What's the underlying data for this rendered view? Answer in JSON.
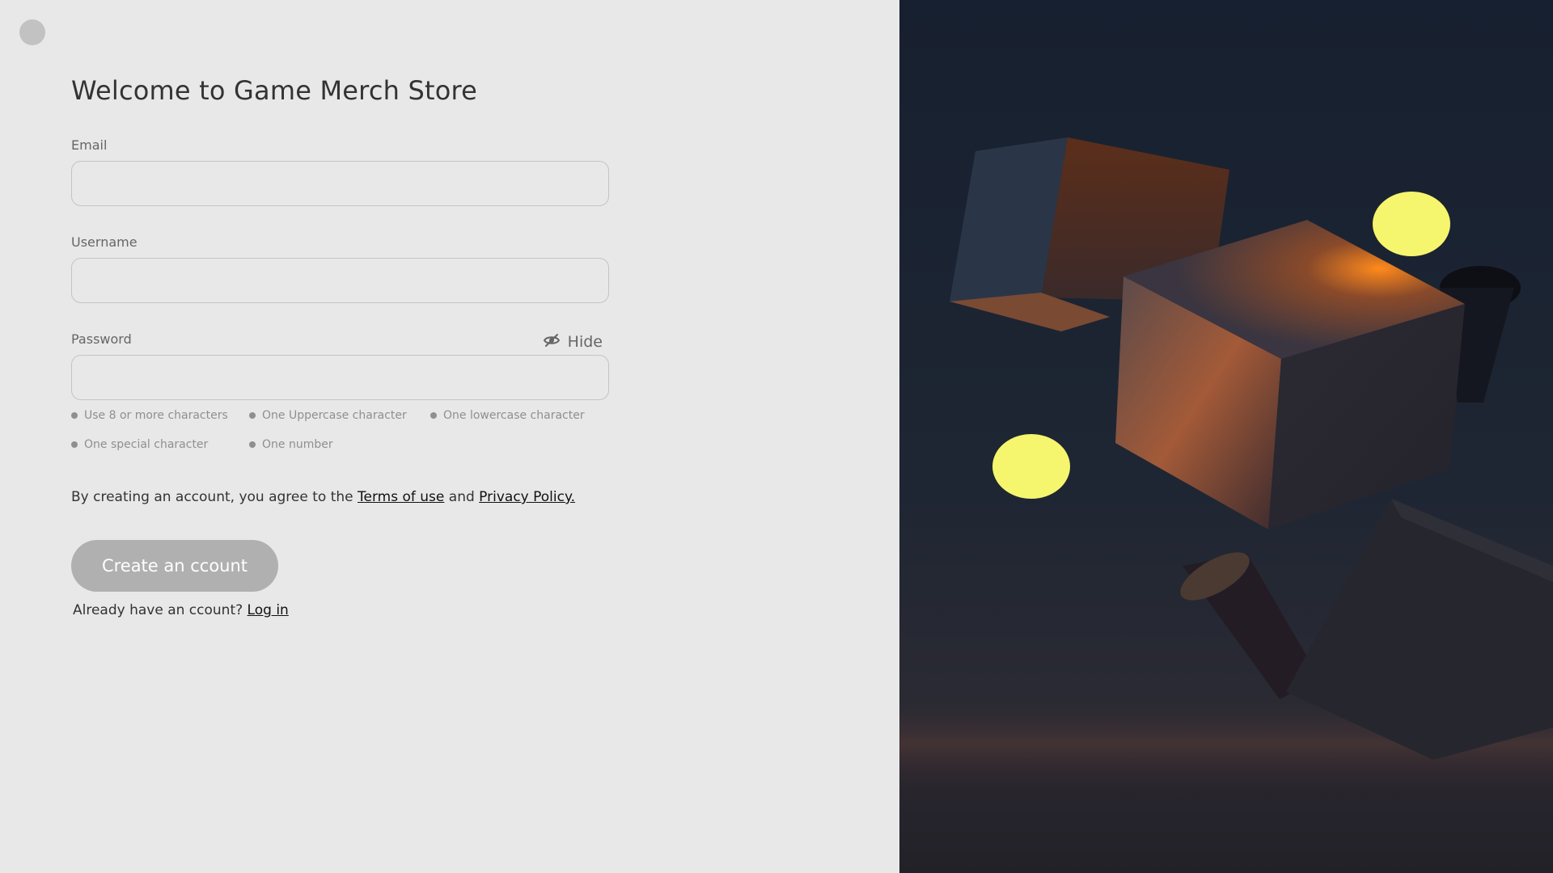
{
  "page": {
    "title": "Welcome to Game Merch Store"
  },
  "form": {
    "email": {
      "label": "Email",
      "value": "",
      "placeholder": ""
    },
    "username": {
      "label": "Username",
      "value": "",
      "placeholder": ""
    },
    "password": {
      "label": "Password",
      "value": "",
      "placeholder": "",
      "toggle_label": "Hide",
      "toggle_icon": "eye-slash-icon"
    },
    "password_rules": [
      "Use 8 or more characters",
      "One Uppercase character",
      "One lowercase character",
      "One special character",
      "One number"
    ],
    "terms": {
      "prefix": "By creating an account, you agree to the ",
      "terms_link": "Terms of use",
      "joiner": " and ",
      "privacy_link": "Privacy Policy."
    },
    "submit_label": "Create an ccount",
    "login": {
      "prompt": "Already have an ccount? ",
      "link": "Log in"
    }
  },
  "colors": {
    "background": "#e8e8e8",
    "text": "#333333",
    "muted": "#666666",
    "button_disabled": "#b0b0b0",
    "accent_yellow": "#f6f56e",
    "accent_orange": "#ff8a1c",
    "panel_dark": "#172030"
  }
}
